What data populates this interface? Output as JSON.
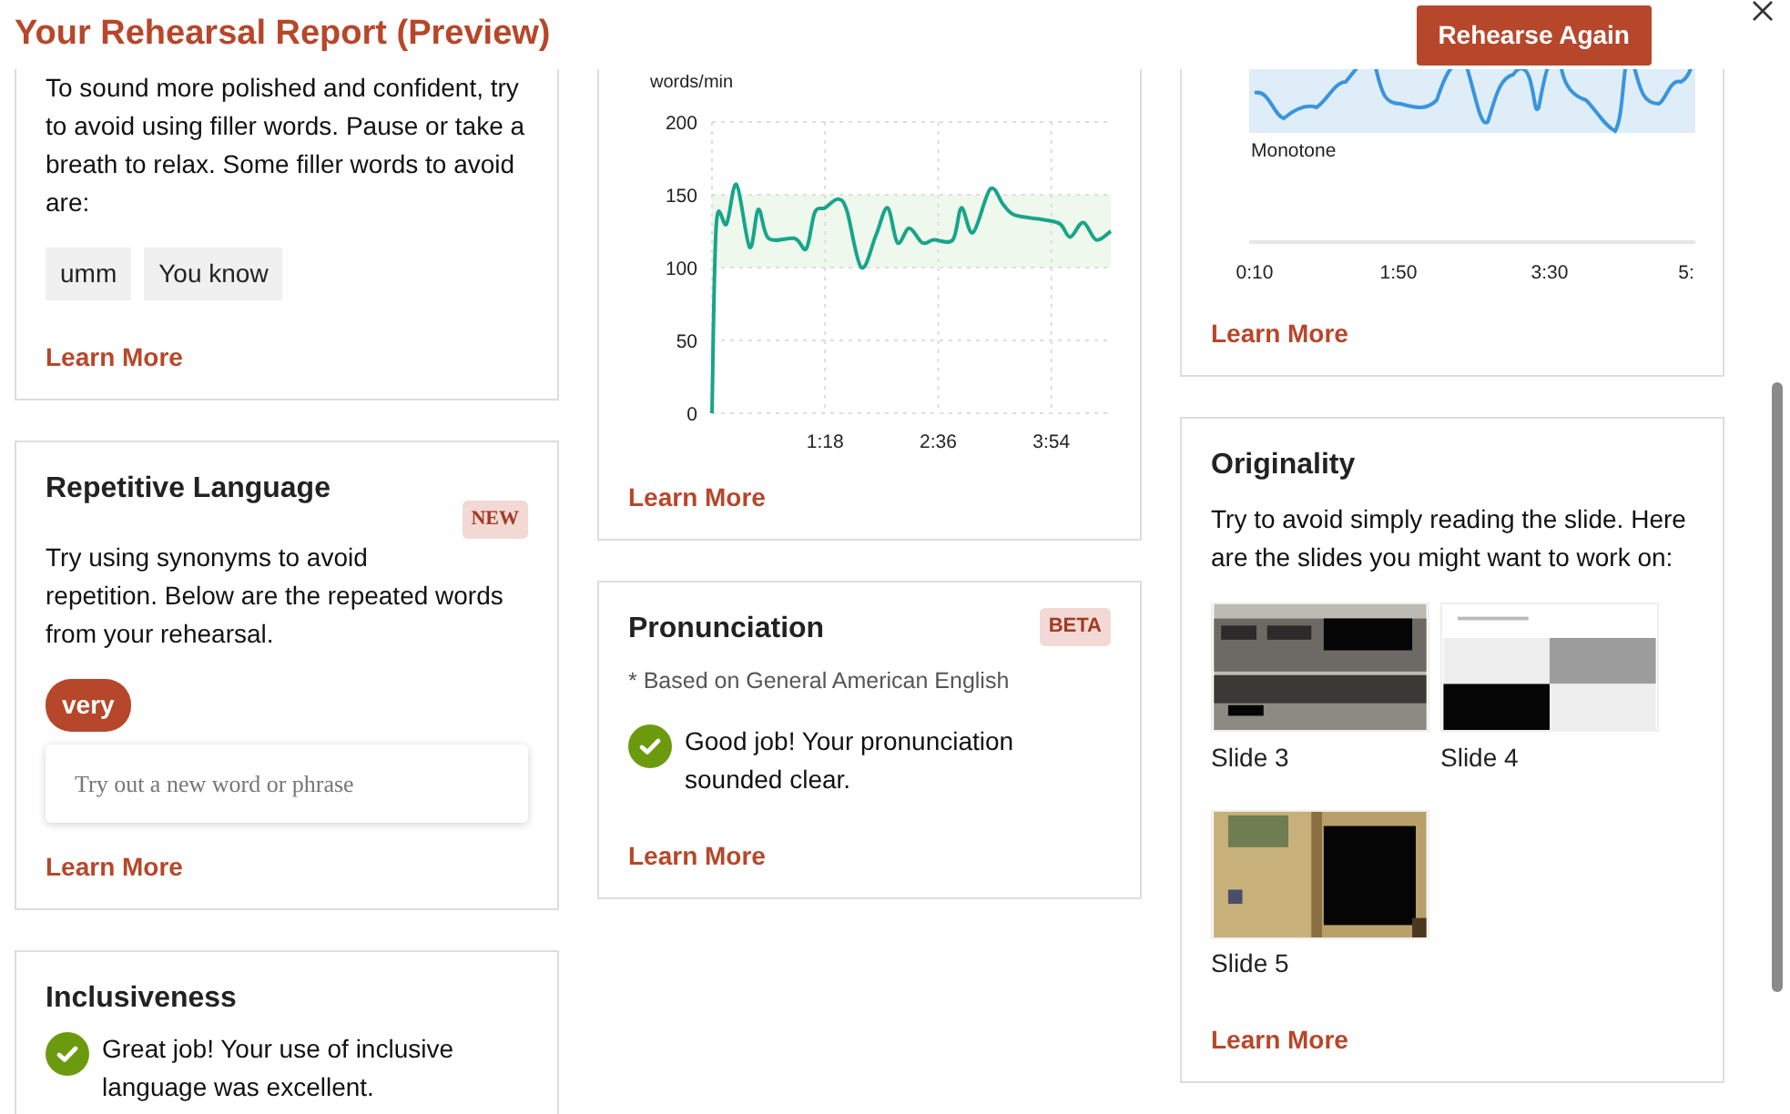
{
  "header": {
    "title": "Your Rehearsal Report (Preview)",
    "button": "Rehearse Again"
  },
  "columns": [
    [
      {
        "kind": "filler",
        "text": "To sound more polished and confident, try to avoid using filler words. Pause or take a breath to relax. Some filler words to avoid are:",
        "chips": [
          "umm",
          "You know"
        ],
        "link": "Learn More"
      },
      {
        "kind": "repetitive",
        "title": "Repetitive Language",
        "badge": {
          "text": "NEW"
        },
        "text": "Try using synonyms to avoid repetition. Below are the repeated words from your rehearsal.",
        "words": [
          "very"
        ],
        "input": {
          "placeholder": "Try out a new word or phrase"
        },
        "link": "Learn More"
      },
      {
        "kind": "check",
        "title": "Inclusiveness",
        "result": "Great job! Your use of inclusive language was excellent."
      }
    ],
    [
      {
        "kind": "pace",
        "chart_data": {
          "type": "line",
          "ylabel": "words/min",
          "x": [
            0,
            3,
            10,
            17,
            26,
            32,
            39,
            57,
            65,
            71,
            78,
            87,
            93,
            103,
            113,
            121,
            128,
            136,
            145,
            153,
            166,
            172,
            180,
            192,
            201,
            209,
            228,
            240,
            247,
            256,
            265,
            275
          ],
          "series": [
            {
              "color": "#17a589",
              "values": [
                0,
                130,
                130,
                157,
                114,
                140,
                120,
                120,
                113,
                138,
                141,
                147,
                139,
                100,
                122,
                141,
                117,
                127,
                117,
                119,
                119,
                141,
                124,
                154,
                143,
                136,
                133,
                130,
                121,
                131,
                119,
                125
              ]
            }
          ],
          "xlim": [
            0,
            275
          ],
          "ylim": [
            0,
            200
          ],
          "yticks": [
            0,
            50,
            100,
            150,
            200
          ],
          "xticks": [
            {
              "value": 78,
              "label": "1:18"
            },
            {
              "value": 156,
              "label": "2:36"
            },
            {
              "value": 234,
              "label": "3:54"
            }
          ],
          "grid": true,
          "bands": [
            {
              "axis": "y",
              "from": 100,
              "to": 150
            }
          ]
        },
        "link": "Learn More"
      },
      {
        "kind": "check",
        "title": "Pronunciation",
        "badge": {
          "text": "BETA"
        },
        "note": "* Based on General American English",
        "result": "Good job! Your pronunciation sounded clear.",
        "link": "Learn More"
      }
    ],
    [
      {
        "kind": "pitch",
        "band_label": "Monotone",
        "ticks": [
          "0:10",
          "1:50",
          "3:30",
          "5:"
        ],
        "link": "Learn More"
      },
      {
        "kind": "originality",
        "title": "Originality",
        "text": "Try to avoid simply reading the slide. Here are the slides you might want to work on:",
        "slides": [
          {
            "label": "Slide 3"
          },
          {
            "label": "Slide 4"
          },
          {
            "label": "Slide 5"
          }
        ],
        "link": "Learn More"
      }
    ]
  ]
}
